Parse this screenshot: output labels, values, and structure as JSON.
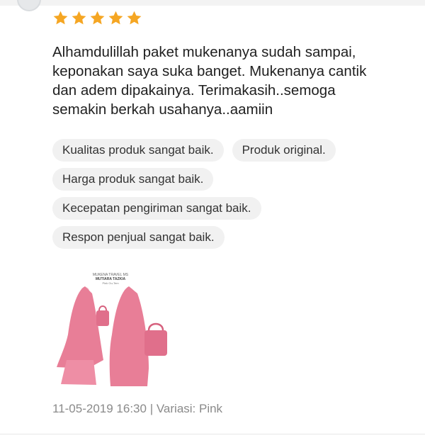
{
  "review": {
    "rating": 5,
    "rating_max": 5,
    "star_color": "#F5A623",
    "text": "Alhamdulillah paket mukenanya sudah sampai,\nkeponakan saya suka banget. Mukenanya cantik\ndan adem dipakainya. Terimakasih..semoga\nsemakin berkah usahanya..aamiin",
    "tags": [
      "Kualitas produk sangat baik.",
      "Produk original.",
      "Harga produk sangat baik.",
      "Kecepatan pengiriman sangat baik.",
      "Respon penjual sangat baik."
    ],
    "photo": {
      "caption_line1": "MUKENA TRAVEL MS",
      "caption_line2": "MUTIARA TAZKIA",
      "caption_line3": "Pink Ou-Tem",
      "garment_color": "#E87E97"
    },
    "timestamp": "11-05-2019 16:30",
    "separator": " | ",
    "variation": "Variasi: Pink"
  }
}
